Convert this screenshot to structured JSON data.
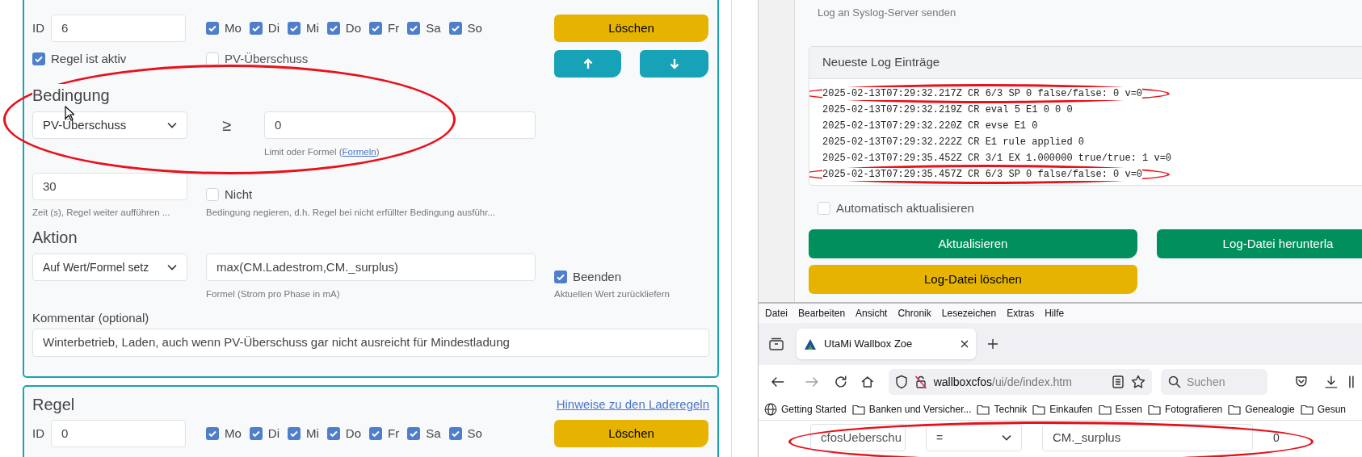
{
  "rule_card": {
    "id_label": "ID",
    "id_value": "6",
    "days": [
      {
        "label": "Mo",
        "checked": true
      },
      {
        "label": "Di",
        "checked": true
      },
      {
        "label": "Mi",
        "checked": true
      },
      {
        "label": "Do",
        "checked": true
      },
      {
        "label": "Fr",
        "checked": true
      },
      {
        "label": "Sa",
        "checked": true
      },
      {
        "label": "So",
        "checked": true
      }
    ],
    "delete_button": "Löschen",
    "active": {
      "label": "Regel ist aktiv",
      "checked": true
    },
    "pv_surplus": {
      "label": "PV-Überschuss",
      "checked": false
    },
    "condition": {
      "heading": "Bedingung",
      "source": "PV-Überschuss",
      "operator": "≥",
      "value": "0",
      "hint": "Limit oder Formel (",
      "hint_link": "Formeln",
      "hint_end": ")",
      "highlighted": true
    },
    "duration": {
      "value": "30",
      "hint": "Zeit (s), Regel weiter aufführen ..."
    },
    "negate": {
      "label": "Nicht",
      "checked": false,
      "hint": "Bedingung negieren, d.h. Regel bei nicht erfüllter Bedingung ausführ..."
    },
    "action": {
      "heading": "Aktion",
      "type": "Auf Wert/Formel setz",
      "formula": "max(CM.Ladestrom,CM._surplus)",
      "formula_hint": "Formel (Strom pro Phase in mA)",
      "stop": {
        "label": "Beenden",
        "checked": true
      },
      "stop_hint": "Aktuellen Wert zurückliefern"
    },
    "comment": {
      "label": "Kommentar (optional)",
      "value": "Winterbetrieb, Laden, auch wenn PV-Überschuss gar nicht ausreicht für Mindestladung"
    }
  },
  "next_rule_card": {
    "heading": "Regel",
    "help_link": "Hinweise zu den Laderegeln",
    "id_label": "ID",
    "id_value": "0",
    "days": [
      {
        "label": "Mo",
        "checked": true
      },
      {
        "label": "Di",
        "checked": true
      },
      {
        "label": "Mi",
        "checked": true
      },
      {
        "label": "Do",
        "checked": true
      },
      {
        "label": "Fr",
        "checked": true
      },
      {
        "label": "Sa",
        "checked": true
      },
      {
        "label": "So",
        "checked": true
      }
    ],
    "delete_button": "Löschen"
  },
  "log_window": {
    "syslog_hint": "Log an Syslog-Server senden",
    "log_title": "Neueste Log Einträge",
    "log_lines": [
      {
        "text": "2025-02-13T07:29:32.217Z CR 6/3 SP 0 false/false: 0 v=0",
        "highlighted": true
      },
      {
        "text": "2025-02-13T07:29:32.219Z CR eval 5 E1 0 0 0",
        "highlighted": false
      },
      {
        "text": "2025-02-13T07:29:32.220Z CR evse E1 0",
        "highlighted": false
      },
      {
        "text": "2025-02-13T07:29:32.222Z CR E1 rule applied 0",
        "highlighted": false
      },
      {
        "text": "2025-02-13T07:29:35.452Z CR 3/1 EX 1.000000 true/true: 1 v=0",
        "highlighted": false
      },
      {
        "text": "2025-02-13T07:29:35.457Z CR 6/3 SP 0 false/false: 0 v=0",
        "highlighted": true
      }
    ],
    "auto_refresh": {
      "label": "Automatisch aktualisieren",
      "checked": false
    },
    "buttons": [
      {
        "label": "Aktualisieren",
        "kind": "success"
      },
      {
        "label": "Log-Datei herunterla",
        "kind": "success"
      },
      {
        "label": "Log-Datei löschen",
        "kind": "warning"
      }
    ]
  },
  "browser": {
    "menu": [
      "Datei",
      "Bearbeiten",
      "Ansicht",
      "Chronik",
      "Lesezeichen",
      "Extras",
      "Hilfe"
    ],
    "tabs": [
      {
        "title": "UtaMi Wallbox Zoe",
        "selected": true
      }
    ],
    "forward_disabled": true,
    "url_host": "wallboxcfos",
    "url_path": "/ui/de/index.htm",
    "search_placeholder": "Suchen",
    "bookmarks": [
      {
        "label": "Getting Started",
        "kind": "globe"
      },
      {
        "label": "Banken und Versicher...",
        "kind": "folder"
      },
      {
        "label": "Technik",
        "kind": "folder"
      },
      {
        "label": "Einkaufen",
        "kind": "folder"
      },
      {
        "label": "Essen",
        "kind": "folder"
      },
      {
        "label": "Fotografieren",
        "kind": "folder"
      },
      {
        "label": "Genealogie",
        "kind": "folder"
      },
      {
        "label": "Gesun",
        "kind": "folder"
      }
    ],
    "content_row": {
      "name": "cfosUeberschu",
      "operator": "=",
      "formula": "CM._surplus",
      "value": "0",
      "highlighted": true
    }
  }
}
